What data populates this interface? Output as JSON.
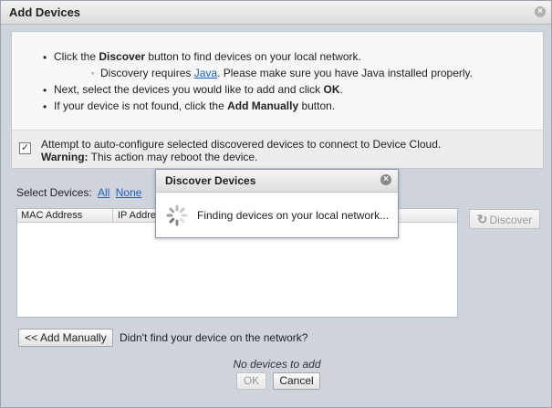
{
  "dialog": {
    "title": "Add Devices",
    "close_icon": "close-circle-icon"
  },
  "instructions": {
    "line1_pre": "Click the ",
    "line1_bold": "Discover",
    "line1_post": " button to find devices on your local network.",
    "line2_pre": "Discovery requires ",
    "line2_link": "Java",
    "line2_post": ". Please make sure you have Java installed properly.",
    "line3_pre": "Next, select the devices you would like to add and click ",
    "line3_bold": "OK",
    "line3_post": ".",
    "line4_pre": "If your device is not found, click the ",
    "line4_bold": "Add Manually",
    "line4_post": " button."
  },
  "auto_config": {
    "checked": true,
    "label": "Attempt to auto-configure selected discovered devices to connect to Device Cloud.",
    "warning_label": "Warning:",
    "warning_text": " This action may reboot the device."
  },
  "select_devices": {
    "label": "Select Devices:",
    "all_link": "All",
    "none_link": "None"
  },
  "device_list": {
    "columns": [
      "MAC Address",
      "IP Address"
    ]
  },
  "buttons": {
    "discover": "Discover",
    "add_manually": "<< Add Manually",
    "ok": "OK",
    "cancel": "Cancel"
  },
  "footer": {
    "not_found_text": "Didn't find your device on the network?",
    "no_devices": "No devices to add"
  },
  "discover_dialog": {
    "title": "Discover Devices",
    "status": "Finding devices on your local network..."
  },
  "icons": {
    "refresh": "refresh-icon",
    "spinner": "loading-spinner-icon"
  }
}
